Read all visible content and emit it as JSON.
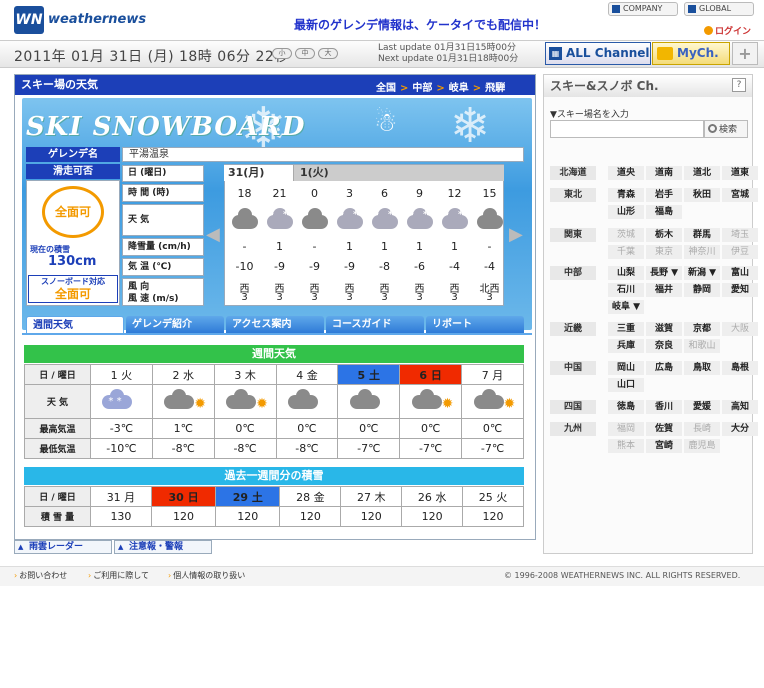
{
  "header": {
    "logo_mark": "WN",
    "logo_text": "weathernews",
    "headline": "最新のゲレンデ情報は、ケータイでも配信中！",
    "company": "COMPANY",
    "global": "GLOBAL",
    "login": "ログイン"
  },
  "datebar": {
    "datetime": "2011年 01月 31日 (月)  18時 06分 22秒",
    "font_small": "小",
    "font_mid": "中",
    "font_large": "大",
    "last_update": "Last update  01月31日15時00分",
    "next_update": "Next update  01月31日18時00分",
    "all_channel": "ALL Channel",
    "mych": "MyCh.",
    "plus": "+"
  },
  "main": {
    "title": "スキー場の天気",
    "crumbs": [
      "全国",
      "中部",
      "岐阜",
      "飛騨"
    ],
    "banner_title": "SKI  SNOWBOARD",
    "resort_label": "ゲレンデ名",
    "resort_name": "平湯温泉",
    "ok_label": "滑走可否",
    "ok_value": "全面可",
    "snow_label": "現在の積雪",
    "snow_value": "130cm",
    "sb_label": "スノーボード対応",
    "sb_value": "全面可",
    "row_labels": [
      "日 (曜日)",
      "時 間 (時)",
      "天 気",
      "降雪量 (cm/h)",
      "気 温 (℃)",
      "風 向",
      "風 速 (m/s)"
    ],
    "day1": "31(月)",
    "day2": "1(火)",
    "hours": [
      "18",
      "21",
      "0",
      "3",
      "6",
      "9",
      "12",
      "15"
    ],
    "weather": [
      "cloud",
      "snow",
      "cloud",
      "snow",
      "snow",
      "snow",
      "snow",
      "cloud"
    ],
    "snowfall": [
      "-",
      "1",
      "-",
      "1",
      "1",
      "1",
      "1",
      "-"
    ],
    "temp": [
      "-10",
      "-9",
      "-9",
      "-9",
      "-8",
      "-6",
      "-4",
      "-4"
    ],
    "wind_dir": [
      "西",
      "西",
      "西",
      "西",
      "西",
      "西",
      "西",
      "北西"
    ],
    "wind_speed": [
      "3",
      "3",
      "3",
      "3",
      "3",
      "3",
      "3",
      "3"
    ],
    "tabs": [
      "週間天気",
      "ゲレンデ紹介",
      "アクセス案内",
      "コースガイド",
      "リポート"
    ]
  },
  "weekly": {
    "title": "週間天気",
    "row_day": "日 / 曜日",
    "row_weather": "天 気",
    "row_max": "最高気温",
    "row_min": "最低気温",
    "days": [
      "1 火",
      "2 水",
      "3 木",
      "4 金",
      "5 土",
      "6 日",
      "7 月"
    ],
    "icons": [
      "snow-cloud",
      "cloud-sun",
      "cloud-sun",
      "cloud",
      "cloud",
      "cloud-sun",
      "cloud-sun"
    ],
    "max": [
      "-3℃",
      "1℃",
      "0℃",
      "0℃",
      "0℃",
      "0℃",
      "0℃"
    ],
    "min": [
      "-10℃",
      "-8℃",
      "-8℃",
      "-8℃",
      "-7℃",
      "-7℃",
      "-7℃"
    ]
  },
  "past": {
    "title": "過去一週間分の積雪",
    "row_day": "日 / 曜日",
    "row_snow": "積 雪 量",
    "days": [
      "31 月",
      "30 日",
      "29 土",
      "28 金",
      "27 木",
      "26 水",
      "25 火"
    ],
    "values": [
      "130",
      "120",
      "120",
      "120",
      "120",
      "120",
      "120"
    ]
  },
  "bottom_links": [
    "雨雲レーダー",
    "注意報・警報"
  ],
  "sidebar": {
    "title": "スキー&スノボ Ch.",
    "help": "?",
    "search_label": "▼スキー場名を入力",
    "search_button": "検索"
  },
  "regions": [
    {
      "name": "北海道",
      "prefs": [
        {
          "n": "道央",
          "d": false
        },
        {
          "n": "道南",
          "d": false
        },
        {
          "n": "道北",
          "d": false
        },
        {
          "n": "道東",
          "d": false
        }
      ]
    },
    {
      "name": "東北",
      "prefs": [
        {
          "n": "青森",
          "d": false
        },
        {
          "n": "岩手",
          "d": false
        },
        {
          "n": "秋田",
          "d": false
        },
        {
          "n": "宮城",
          "d": false
        },
        {
          "n": "山形",
          "d": false
        },
        {
          "n": "福島",
          "d": false
        }
      ]
    },
    {
      "name": "関東",
      "prefs": [
        {
          "n": "茨城",
          "d": true
        },
        {
          "n": "栃木",
          "d": false
        },
        {
          "n": "群馬",
          "d": false
        },
        {
          "n": "埼玉",
          "d": true
        },
        {
          "n": "千葉",
          "d": true
        },
        {
          "n": "東京",
          "d": true
        },
        {
          "n": "神奈川",
          "d": true
        },
        {
          "n": "伊豆",
          "d": true
        }
      ]
    },
    {
      "name": "中部",
      "prefs": [
        {
          "n": "山梨",
          "d": false
        },
        {
          "n": "長野 ▼",
          "d": false
        },
        {
          "n": "新潟 ▼",
          "d": false
        },
        {
          "n": "富山",
          "d": false
        },
        {
          "n": "石川",
          "d": false
        },
        {
          "n": "福井",
          "d": false
        },
        {
          "n": "静岡",
          "d": false
        },
        {
          "n": "愛知",
          "d": false
        },
        {
          "n": "岐阜 ▼",
          "d": false
        }
      ]
    },
    {
      "name": "近畿",
      "prefs": [
        {
          "n": "三重",
          "d": false
        },
        {
          "n": "滋賀",
          "d": false
        },
        {
          "n": "京都",
          "d": false
        },
        {
          "n": "大阪",
          "d": true
        },
        {
          "n": "兵庫",
          "d": false
        },
        {
          "n": "奈良",
          "d": false
        },
        {
          "n": "和歌山",
          "d": true
        }
      ]
    },
    {
      "name": "中国",
      "prefs": [
        {
          "n": "岡山",
          "d": false
        },
        {
          "n": "広島",
          "d": false
        },
        {
          "n": "鳥取",
          "d": false
        },
        {
          "n": "島根",
          "d": false
        },
        {
          "n": "山口",
          "d": false
        }
      ]
    },
    {
      "name": "四国",
      "prefs": [
        {
          "n": "徳島",
          "d": false
        },
        {
          "n": "香川",
          "d": false
        },
        {
          "n": "愛媛",
          "d": false
        },
        {
          "n": "高知",
          "d": false
        }
      ]
    },
    {
      "name": "九州",
      "prefs": [
        {
          "n": "福岡",
          "d": true
        },
        {
          "n": "佐賀",
          "d": false
        },
        {
          "n": "長崎",
          "d": true
        },
        {
          "n": "大分",
          "d": false
        },
        {
          "n": "熊本",
          "d": true
        },
        {
          "n": "宮崎",
          "d": false
        },
        {
          "n": "鹿児島",
          "d": true
        }
      ]
    }
  ],
  "footer": {
    "links": [
      "お問い合わせ",
      "ご利用に際して",
      "個人情報の取り扱い"
    ],
    "copyright": "© 1996-2008 WEATHERNEWS INC. ALL RIGHTS RESERVED."
  }
}
